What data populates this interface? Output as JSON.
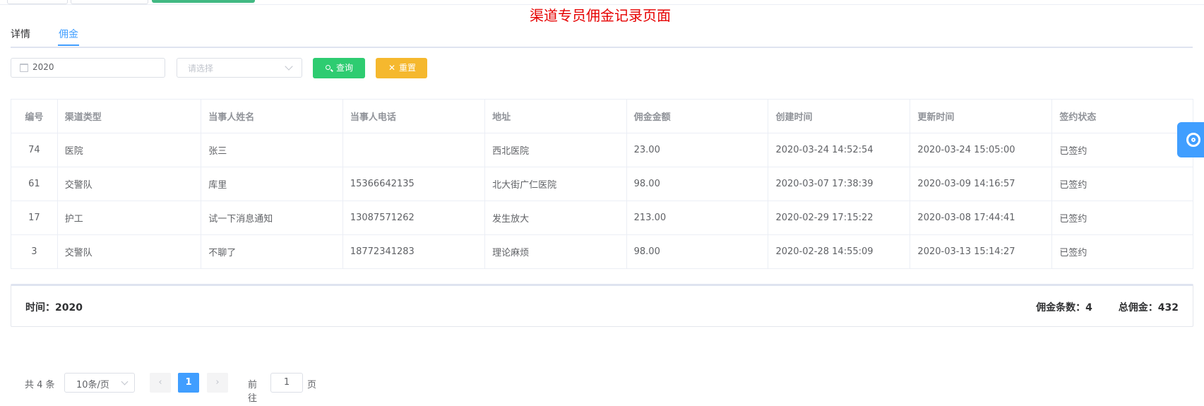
{
  "page_title": "渠道专员佣金记录页面",
  "tabs": [
    {
      "label": "详情"
    },
    {
      "label": "佣金",
      "active": true
    }
  ],
  "filter": {
    "year_value": "2020",
    "select_placeholder": "请选择",
    "search_label": "查询",
    "reset_label": "重置",
    "search_icon": "search-icon",
    "reset_icon": "close-icon",
    "calendar_icon": "calendar-icon"
  },
  "table": {
    "headers": [
      "编号",
      "渠道类型",
      "当事人姓名",
      "当事人电话",
      "地址",
      "佣金金额",
      "创建时间",
      "更新时间",
      "签约状态"
    ],
    "rows": [
      [
        "74",
        "医院",
        "张三",
        "",
        "西北医院",
        "23.00",
        "2020-03-24 14:52:54",
        "2020-03-24 15:05:00",
        "已签约"
      ],
      [
        "61",
        "交警队",
        "库里",
        "15366642135",
        "北大街广仁医院",
        "98.00",
        "2020-03-07 17:38:39",
        "2020-03-09 14:16:57",
        "已签约"
      ],
      [
        "17",
        "护工",
        "试一下消息通知",
        "13087571262",
        "发生放大",
        "213.00",
        "2020-02-29 17:15:22",
        "2020-03-08 17:44:41",
        "已签约"
      ],
      [
        "3",
        "交警队",
        "不聊了",
        "18772341283",
        "理论麻烦",
        "98.00",
        "2020-02-28 14:55:09",
        "2020-03-13 15:14:27",
        "已签约"
      ]
    ]
  },
  "summary": {
    "time_text": "时间：2020",
    "count_text": "佣金条数：4",
    "total_text": "总佣金：432"
  },
  "pagination": {
    "total_text": "共 4 条",
    "page_size": "10条/页",
    "current_page": "1",
    "goto_label": "前往",
    "goto_value": "1",
    "page_word": "页"
  },
  "colors": {
    "accent": "#409eff",
    "search_btn": "#2ecc71",
    "reset_btn": "#f5b82e",
    "title": "#e60000"
  }
}
